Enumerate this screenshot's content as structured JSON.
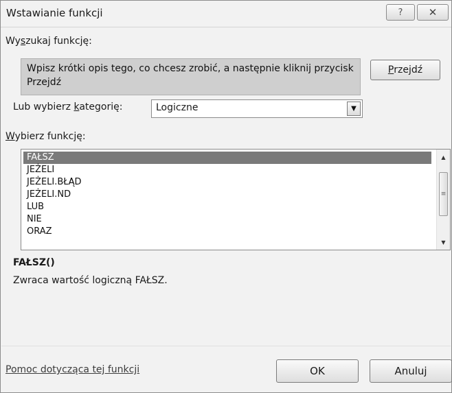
{
  "dialog": {
    "title": "Wstawianie funkcji",
    "help_icon_glyph": "?",
    "close_icon_glyph": "✕"
  },
  "search": {
    "label_pre": "Wy",
    "label_accel": "s",
    "label_post": "zukaj funkcję:",
    "text": "Wpisz krótki opis tego, co chcesz zrobić, a następnie kliknij przycisk Przejdź",
    "go_accel": "P",
    "go_rest": "rzejdź"
  },
  "category": {
    "label_pre": "Lub wybierz ",
    "label_accel": "k",
    "label_post": "ategorię:",
    "selected": "Logiczne",
    "arrow_glyph": "▼"
  },
  "functions": {
    "label_accel": "W",
    "label_post": "ybierz funkcję:",
    "items": [
      "FAŁSZ",
      "JEŻELI",
      "JEŻELI.BŁĄD",
      "JEŻELI.ND",
      "LUB",
      "NIE",
      "ORAZ"
    ],
    "selected_index": 0,
    "scroll_up_glyph": "▲",
    "scroll_down_glyph": "▼",
    "scroll_thumb_glyph": "≡"
  },
  "details": {
    "signature": "FAŁSZ()",
    "description": "Zwraca wartość logiczną FAŁSZ."
  },
  "footer": {
    "help_link": "Pomoc dotycząca tej funkcji",
    "ok": "OK",
    "cancel": "Anuluj"
  }
}
